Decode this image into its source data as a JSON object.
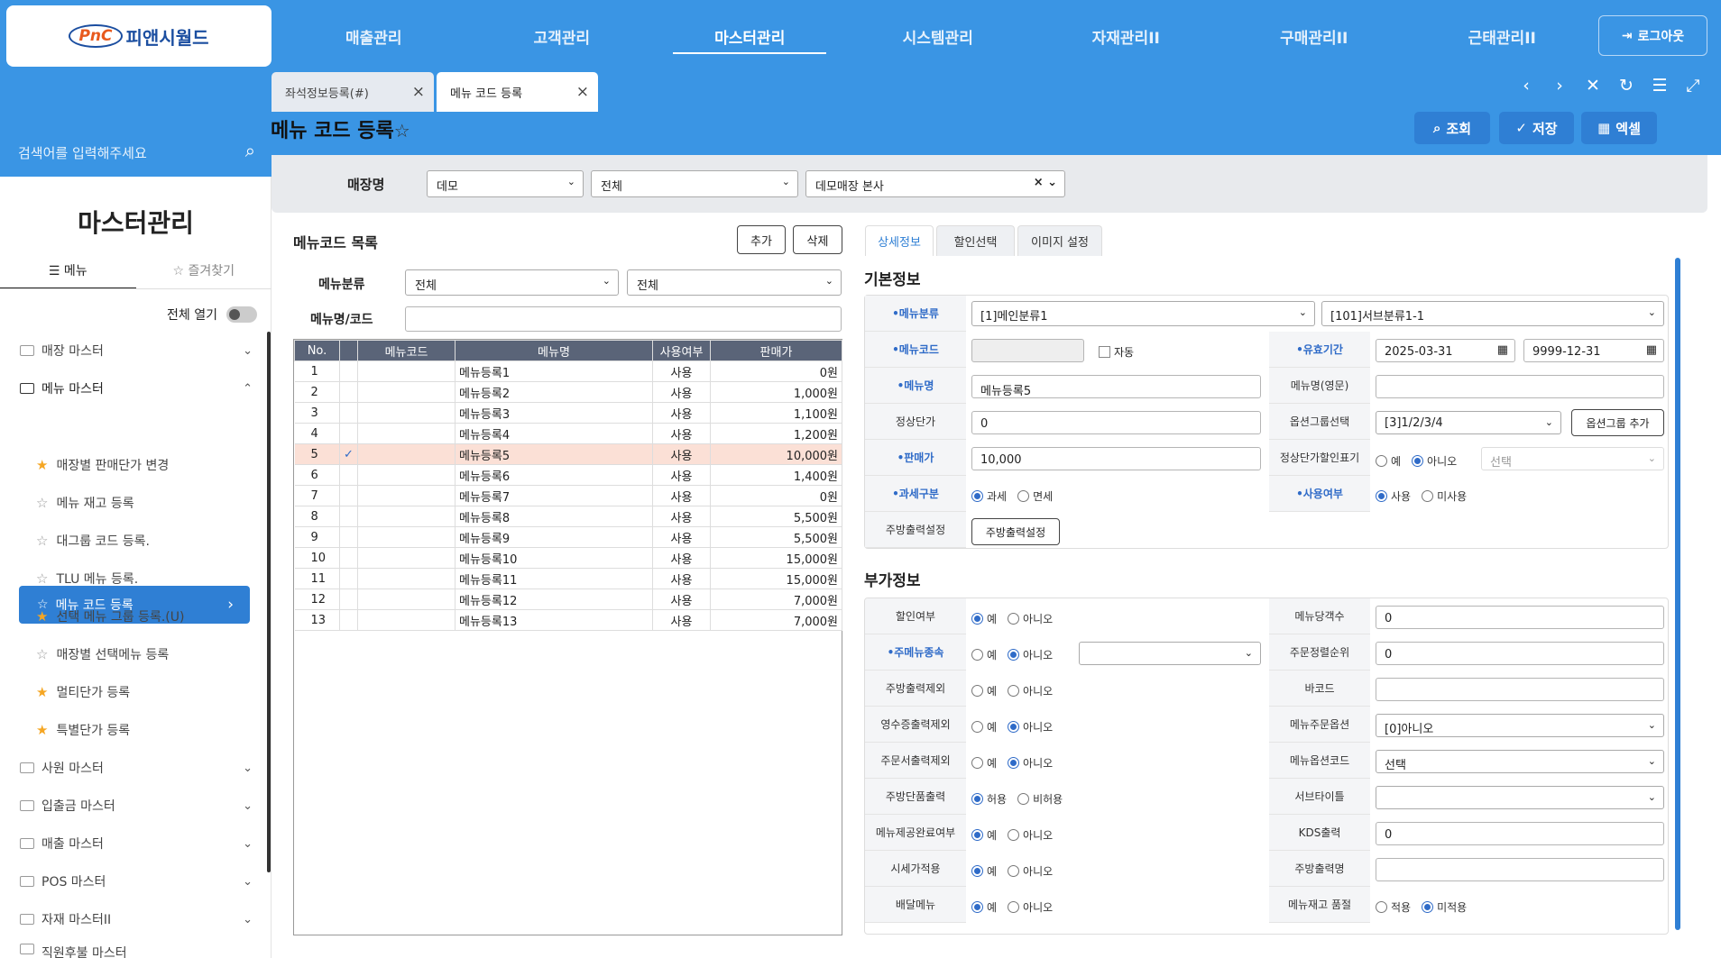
{
  "brand": {
    "short": "PnC",
    "name": "피앤시월드"
  },
  "nav": {
    "items": [
      "매출관리",
      "고객관리",
      "마스터관리",
      "시스템관리",
      "자재관리II",
      "구매관리II",
      "근태관리II"
    ],
    "logout": "로그아웃"
  },
  "tabs": [
    {
      "label": "좌석정보등록(#)"
    },
    {
      "label": "메뉴 코드 등록"
    }
  ],
  "tab_controls": {
    "prev": "‹",
    "next": "›",
    "close": "✕",
    "refresh": "↻",
    "list": "☰",
    "expand": "⤢"
  },
  "page": {
    "title": "메뉴 코드 등록",
    "star": "☆"
  },
  "actions": {
    "search": "조회",
    "save": "저장",
    "excel": "엑셀"
  },
  "sidebar": {
    "search_placeholder": "검색어를 입력해주세요",
    "title": "마스터관리",
    "tab_menu": "메뉴",
    "tab_fav": "즐겨찾기",
    "open_all": "전체 열기",
    "groups": [
      "매장 마스터",
      "메뉴 마스터",
      "사원 마스터",
      "입출금 마스터",
      "매출 마스터",
      "POS 마스터",
      "자재 마스터II",
      "직원후불 마스터"
    ],
    "selected": "메뉴 코드 등록",
    "subs": [
      "매장별 판매단가 변경",
      "메뉴 재고 등록",
      "대그룹 코드 등록.",
      "TLU 메뉴 등록.",
      "선택 메뉴 그룹 등록.(U)",
      "매장별 선택메뉴 등록",
      "멀티단가 등록",
      "특별단가 등록"
    ]
  },
  "filter": {
    "label": "매장명",
    "sel1": "데모",
    "sel2": "전체",
    "sel3": "데모매장 본사"
  },
  "list": {
    "title": "메뉴코드 목록",
    "add": "추가",
    "del": "삭제",
    "cat_label": "메뉴분류",
    "cat1": "전체",
    "cat2": "전체",
    "name_label": "메뉴명/코드",
    "cols": [
      "No.",
      "메뉴코드",
      "메뉴명",
      "사용여부",
      "판매가"
    ],
    "rows": [
      [
        "1",
        "메뉴등록1",
        "사용",
        "0원"
      ],
      [
        "2",
        "메뉴등록2",
        "사용",
        "1,000원"
      ],
      [
        "3",
        "메뉴등록3",
        "사용",
        "1,100원"
      ],
      [
        "4",
        "메뉴등록4",
        "사용",
        "1,200원"
      ],
      [
        "5",
        "메뉴등록5",
        "사용",
        "10,000원"
      ],
      [
        "6",
        "메뉴등록6",
        "사용",
        "1,400원"
      ],
      [
        "7",
        "메뉴등록7",
        "사용",
        "0원"
      ],
      [
        "8",
        "메뉴등록8",
        "사용",
        "5,500원"
      ],
      [
        "9",
        "메뉴등록9",
        "사용",
        "5,500원"
      ],
      [
        "10",
        "메뉴등록10",
        "사용",
        "15,000원"
      ],
      [
        "11",
        "메뉴등록11",
        "사용",
        "15,000원"
      ],
      [
        "12",
        "메뉴등록12",
        "사용",
        "7,000원"
      ],
      [
        "13",
        "메뉴등록13",
        "사용",
        "7,000원"
      ]
    ]
  },
  "detail": {
    "tabs": [
      "상세정보",
      "할인선택",
      "이미지 설정"
    ],
    "basic_title": "기본정보",
    "extra_title": "부가정보",
    "basic": {
      "cat_label": "•메뉴분류",
      "cat1": "[1]메인분류1",
      "cat2": "[101]서브분류1-1",
      "code_label": "•메뉴코드",
      "auto": "자동",
      "period_label": "•유효기간",
      "from": "2025-03-31",
      "to": "9999-12-31",
      "name_label": "•메뉴명",
      "name": "메뉴등록5",
      "name_en_label": "메뉴명(영문)",
      "normal_label": "정상단가",
      "normal": "0",
      "opt_label": "옵션그룹선택",
      "opt": "[3]1/2/3/4",
      "opt_add": "옵션그룹 추가",
      "price_label": "•판매가",
      "price": "10,000",
      "disc_label": "정상단가할인표기",
      "disc_sel": "선택",
      "tax_label": "•과세구분",
      "tax_yes": "과세",
      "tax_no": "면세",
      "use_label": "•사용여부",
      "use_yes": "사용",
      "use_no": "미사용",
      "kitchen_label": "주방출력설정",
      "kitchen_btn": "주방출력설정"
    },
    "extra": {
      "yes": "예",
      "no": "아니오",
      "allow": "허용",
      "disallow": "비허용",
      "apply": "적용",
      "notapply": "미적용",
      "left_labels": [
        "할인여부",
        "•주메뉴종속",
        "주방출력제외",
        "영수증출력제외",
        "주문서출력제외",
        "주방단품출력",
        "메뉴제공완료여부",
        "시세가적용",
        "배달메뉴"
      ],
      "right_labels": [
        "메뉴당객수",
        "주문정렬순위",
        "바코드",
        "메뉴주문옵션",
        "메뉴옵션코드",
        "서브타이틀",
        "KDS출력",
        "주방출력명",
        "메뉴재고 품절"
      ],
      "guest": "0",
      "order": "0",
      "menu_opt": "[0]아니오",
      "opt_code": "선택",
      "kds": "0"
    }
  }
}
